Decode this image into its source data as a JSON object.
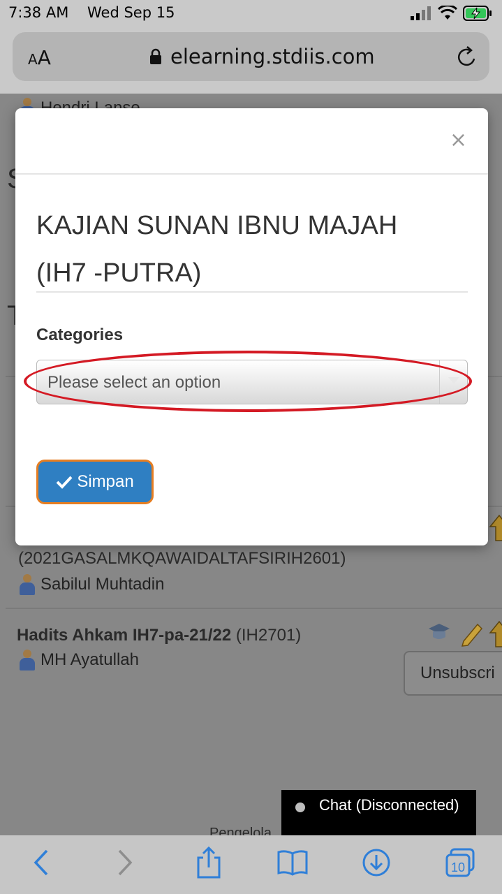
{
  "status": {
    "time": "7:38 AM",
    "date": "Wed Sep 15"
  },
  "browser": {
    "text_size_label_small": "A",
    "text_size_label_large": "A",
    "url": "elearning.stdiis.com",
    "tabs_count": "10"
  },
  "background": {
    "header_fragment": "Hendri Lanse",
    "s_fragment": "S",
    "t_fragment": "T",
    "course_code_line": "(2021GASALMKQAWAIDALTAFSIRIH2601)",
    "instructor_1": "Sabilul Muhtadin",
    "course_2_title": "Hadits Ahkam IH7-pa-21/22",
    "course_2_code": "(IH2701)",
    "instructor_2": "MH Ayatullah",
    "unsubscribe_label": "Unsubscri",
    "footer_fragment": "Pengelola",
    "chat_label": "Chat (Disconnected)"
  },
  "modal": {
    "close_label": "×",
    "title_line1": "KAJIAN SUNAN IBNU MAJAH",
    "title_line2": "(IH7 -PUTRA)",
    "categories_label": "Categories",
    "select_placeholder": "Please select an option",
    "save_label": "Simpan"
  },
  "colors": {
    "annotation_red": "#d41a24",
    "annotation_orange": "#e67e22",
    "primary_button": "#2f7fc2",
    "toolbar_icon": "#2f7fd8"
  },
  "icons": [
    "lock-icon",
    "reload-icon",
    "back-icon",
    "forward-icon",
    "share-icon",
    "bookmarks-icon",
    "download-icon",
    "tabs-icon",
    "check-icon",
    "person-icon",
    "pencil-icon"
  ]
}
